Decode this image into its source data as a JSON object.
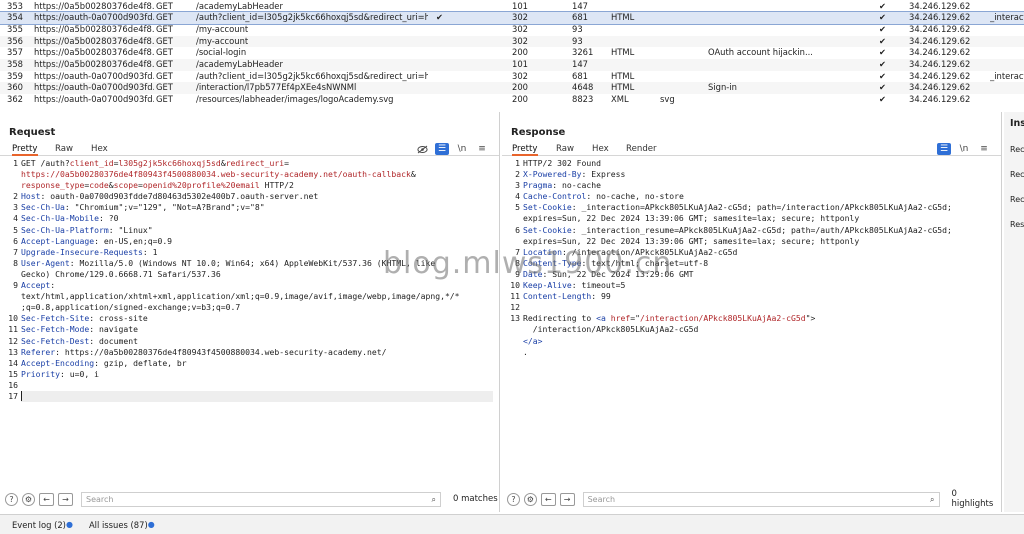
{
  "history": {
    "rows": [
      {
        "num": "353",
        "host": "https://0a5b00280376de4f8...",
        "method": "GET",
        "url": "/academyLabHeader",
        "edited": "",
        "status": "101",
        "length": "147",
        "mime": "",
        "ext": "",
        "title": "",
        "tls": "✔",
        "ip": "34.246.129.62",
        "cookies": "",
        "selected": false
      },
      {
        "num": "354",
        "host": "https://oauth-0a0700d903fd...",
        "method": "GET",
        "url": "/auth?client_id=l305g2jk5kc66hoxqj5sd&redirect_uri=https:/...",
        "edited": "✔",
        "status": "302",
        "length": "681",
        "mime": "HTML",
        "ext": "",
        "title": "",
        "tls": "✔",
        "ip": "34.246.129.62",
        "cookies": "_interacti",
        "selected": true
      },
      {
        "num": "355",
        "host": "https://0a5b00280376de4f8...",
        "method": "GET",
        "url": "/my-account",
        "edited": "",
        "status": "302",
        "length": "93",
        "mime": "",
        "ext": "",
        "title": "",
        "tls": "✔",
        "ip": "34.246.129.62",
        "cookies": "",
        "selected": false
      },
      {
        "num": "356",
        "host": "https://0a5b00280376de4f8...",
        "method": "GET",
        "url": "/my-account",
        "edited": "",
        "status": "302",
        "length": "93",
        "mime": "",
        "ext": "",
        "title": "",
        "tls": "✔",
        "ip": "34.246.129.62",
        "cookies": "",
        "selected": false
      },
      {
        "num": "357",
        "host": "https://0a5b00280376de4f8...",
        "method": "GET",
        "url": "/social-login",
        "edited": "",
        "status": "200",
        "length": "3261",
        "mime": "HTML",
        "ext": "",
        "title": "OAuth account hijackin...",
        "tls": "✔",
        "ip": "34.246.129.62",
        "cookies": "",
        "selected": false
      },
      {
        "num": "358",
        "host": "https://0a5b00280376de4f8...",
        "method": "GET",
        "url": "/academyLabHeader",
        "edited": "",
        "status": "101",
        "length": "147",
        "mime": "",
        "ext": "",
        "title": "",
        "tls": "✔",
        "ip": "34.246.129.62",
        "cookies": "",
        "selected": false
      },
      {
        "num": "359",
        "host": "https://oauth-0a0700d903fd...",
        "method": "GET",
        "url": "/auth?client_id=l305g2jk5kc66hoxqj5sd&redirect_uri=https:/...",
        "edited": "",
        "status": "302",
        "length": "681",
        "mime": "HTML",
        "ext": "",
        "title": "",
        "tls": "✔",
        "ip": "34.246.129.62",
        "cookies": "_interacti",
        "selected": false
      },
      {
        "num": "360",
        "host": "https://oauth-0a0700d903fd...",
        "method": "GET",
        "url": "/interaction/l7pb577Ef4pXEe4sNWNMl",
        "edited": "",
        "status": "200",
        "length": "4648",
        "mime": "HTML",
        "ext": "",
        "title": "Sign-in",
        "tls": "✔",
        "ip": "34.246.129.62",
        "cookies": "",
        "selected": false
      },
      {
        "num": "362",
        "host": "https://oauth-0a0700d903fd...",
        "method": "GET",
        "url": "/resources/labheader/images/logoAcademy.svg",
        "edited": "",
        "status": "200",
        "length": "8823",
        "mime": "XML",
        "ext": "svg",
        "title": "",
        "tls": "✔",
        "ip": "34.246.129.62",
        "cookies": "",
        "selected": false
      }
    ]
  },
  "request": {
    "title": "Request",
    "tabs": [
      "Pretty",
      "Raw",
      "Hex"
    ],
    "lines": [
      [
        {
          "t": "GET /auth?",
          "c": ""
        },
        {
          "t": "client_id",
          "c": "pname"
        },
        {
          "t": "=",
          "c": ""
        },
        {
          "t": "l305g2jk5kc66hoxqj5sd",
          "c": "pval"
        },
        {
          "t": "&",
          "c": ""
        },
        {
          "t": "redirect_uri",
          "c": "pname"
        },
        {
          "t": "=",
          "c": ""
        }
      ],
      [
        {
          "t": "https://0a5b00280376de4f80943f4500880034.web-security-academy.net/oauth-callback",
          "c": "pval"
        },
        {
          "t": "&",
          "c": ""
        }
      ],
      [
        {
          "t": "response_type",
          "c": "pname"
        },
        {
          "t": "=",
          "c": ""
        },
        {
          "t": "code",
          "c": "pval"
        },
        {
          "t": "&",
          "c": ""
        },
        {
          "t": "scope",
          "c": "pname"
        },
        {
          "t": "=",
          "c": ""
        },
        {
          "t": "openid%20profile%20email",
          "c": "pval"
        },
        {
          "t": " HTTP/2",
          "c": ""
        }
      ],
      [
        {
          "t": "Host",
          "c": "hname"
        },
        {
          "t": ": oauth-0a0700d903fdde7d80463d5302e400b7.oauth-server.net",
          "c": ""
        }
      ],
      [
        {
          "t": "Sec-Ch-Ua",
          "c": "hname"
        },
        {
          "t": ": \"Chromium\";v=\"129\", \"Not=A?Brand\";v=\"8\"",
          "c": ""
        }
      ],
      [
        {
          "t": "Sec-Ch-Ua-Mobile",
          "c": "hname"
        },
        {
          "t": ": ?0",
          "c": ""
        }
      ],
      [
        {
          "t": "Sec-Ch-Ua-Platform",
          "c": "hname"
        },
        {
          "t": ": \"Linux\"",
          "c": ""
        }
      ],
      [
        {
          "t": "Accept-Language",
          "c": "hname"
        },
        {
          "t": ": en-US,en;q=0.9",
          "c": ""
        }
      ],
      [
        {
          "t": "Upgrade-Insecure-Requests",
          "c": "hname"
        },
        {
          "t": ": 1",
          "c": ""
        }
      ],
      [
        {
          "t": "User-Agent",
          "c": "hname"
        },
        {
          "t": ": Mozilla/5.0 (Windows NT 10.0; Win64; x64) AppleWebKit/537.36 (KHTML, like",
          "c": ""
        }
      ],
      [
        {
          "t": "Gecko) Chrome/129.0.6668.71 Safari/537.36",
          "c": ""
        }
      ],
      [
        {
          "t": "Accept",
          "c": "hname"
        },
        {
          "t": ":",
          "c": ""
        }
      ],
      [
        {
          "t": "text/html,application/xhtml+xml,application/xml;q=0.9,image/avif,image/webp,image/apng,*/*",
          "c": ""
        }
      ],
      [
        {
          "t": ";q=0.8,application/signed-exchange;v=b3;q=0.7",
          "c": ""
        }
      ],
      [
        {
          "t": "Sec-Fetch-Site",
          "c": "hname"
        },
        {
          "t": ": cross-site",
          "c": ""
        }
      ],
      [
        {
          "t": "Sec-Fetch-Mode",
          "c": "hname"
        },
        {
          "t": ": navigate",
          "c": ""
        }
      ],
      [
        {
          "t": "Sec-Fetch-Dest",
          "c": "hname"
        },
        {
          "t": ": document",
          "c": ""
        }
      ],
      [
        {
          "t": "Referer",
          "c": "hname"
        },
        {
          "t": ": https://0a5b00280376de4f80943f4500880034.web-security-academy.net/",
          "c": ""
        }
      ],
      [
        {
          "t": "Accept-Encoding",
          "c": "hname"
        },
        {
          "t": ": gzip, deflate, br",
          "c": ""
        }
      ],
      [
        {
          "t": "Priority",
          "c": "hname"
        },
        {
          "t": ": u=0, i",
          "c": ""
        }
      ],
      [],
      []
    ],
    "gutter": [
      "1",
      "",
      "",
      "2",
      "3",
      "4",
      "5",
      "6",
      "7",
      "8",
      "",
      "9",
      "",
      "",
      "10",
      "11",
      "12",
      "13",
      "14",
      "15",
      "16",
      "17"
    ],
    "search_placeholder": "Search",
    "match_count": "0 matches"
  },
  "response": {
    "title": "Response",
    "tabs": [
      "Pretty",
      "Raw",
      "Hex",
      "Render"
    ],
    "lines": [
      [
        {
          "t": "HTTP/2 302 Found",
          "c": ""
        }
      ],
      [
        {
          "t": "X-Powered-By",
          "c": "hname"
        },
        {
          "t": ": Express",
          "c": ""
        }
      ],
      [
        {
          "t": "Pragma",
          "c": "hname"
        },
        {
          "t": ": no-cache",
          "c": ""
        }
      ],
      [
        {
          "t": "Cache-Control",
          "c": "hname"
        },
        {
          "t": ": no-cache, no-store",
          "c": ""
        }
      ],
      [
        {
          "t": "Set-Cookie",
          "c": "hname"
        },
        {
          "t": ": _interaction=APkck805LKuAjAa2-cG5d; path=/interaction/APkck805LKuAjAa2-cG5d;",
          "c": ""
        }
      ],
      [
        {
          "t": "expires=Sun, 22 Dec 2024 13:39:06 GMT; samesite=lax; secure; httponly",
          "c": ""
        }
      ],
      [
        {
          "t": "Set-Cookie",
          "c": "hname"
        },
        {
          "t": ": _interaction_resume=APkck805LKuAjAa2-cG5d; path=/auth/APkck805LKuAjAa2-cG5d;",
          "c": ""
        }
      ],
      [
        {
          "t": "expires=Sun, 22 Dec 2024 13:39:06 GMT; samesite=lax; secure; httponly",
          "c": ""
        }
      ],
      [
        {
          "t": "Location",
          "c": "hname"
        },
        {
          "t": ": /interaction/APkck805LKuAjAa2-cG5d",
          "c": ""
        }
      ],
      [
        {
          "t": "Content-Type",
          "c": "hname"
        },
        {
          "t": ": text/html; charset=utf-8",
          "c": ""
        }
      ],
      [
        {
          "t": "Date",
          "c": "hname"
        },
        {
          "t": ": Sun, 22 Dec 2024 13:29:06 GMT",
          "c": ""
        }
      ],
      [
        {
          "t": "Keep-Alive",
          "c": "hname"
        },
        {
          "t": ": timeout=5",
          "c": ""
        }
      ],
      [
        {
          "t": "Content-Length",
          "c": "hname"
        },
        {
          "t": ": 99",
          "c": ""
        }
      ],
      [],
      [
        {
          "t": "Redirecting to ",
          "c": ""
        },
        {
          "t": "<a ",
          "c": "hname"
        },
        {
          "t": "href",
          "c": "pname"
        },
        {
          "t": "=\"",
          "c": ""
        },
        {
          "t": "/interaction/APkck805LKuAjAa2-cG5d",
          "c": "pval"
        },
        {
          "t": "\">",
          "c": ""
        }
      ],
      [
        {
          "t": "  /interaction/APkck805LKuAjAa2-cG5d",
          "c": ""
        }
      ],
      [
        {
          "t": "</a>",
          "c": "hname"
        }
      ],
      [
        {
          "t": ".",
          "c": ""
        }
      ]
    ],
    "gutter": [
      "1",
      "2",
      "3",
      "4",
      "5",
      "",
      "6",
      "",
      "7",
      "8",
      "9",
      "10",
      "11",
      "12",
      "13",
      "",
      "",
      ""
    ],
    "search_placeholder": "Search",
    "match_count": "0 highlights"
  },
  "inspector": {
    "title": "Ins",
    "items": [
      "Rec",
      "Rec",
      "Rec",
      "Res"
    ]
  },
  "bottom": {
    "event_log": "Event log (2)",
    "all_issues": "All issues (87)"
  },
  "watermark": "blog.mlws1900.cn",
  "colors": {
    "accent": "#e8642c",
    "selection": "#dde6f5",
    "header_name": "#1a3fa6",
    "param": "#b0272a",
    "toggle_on": "#2f6fd6"
  }
}
